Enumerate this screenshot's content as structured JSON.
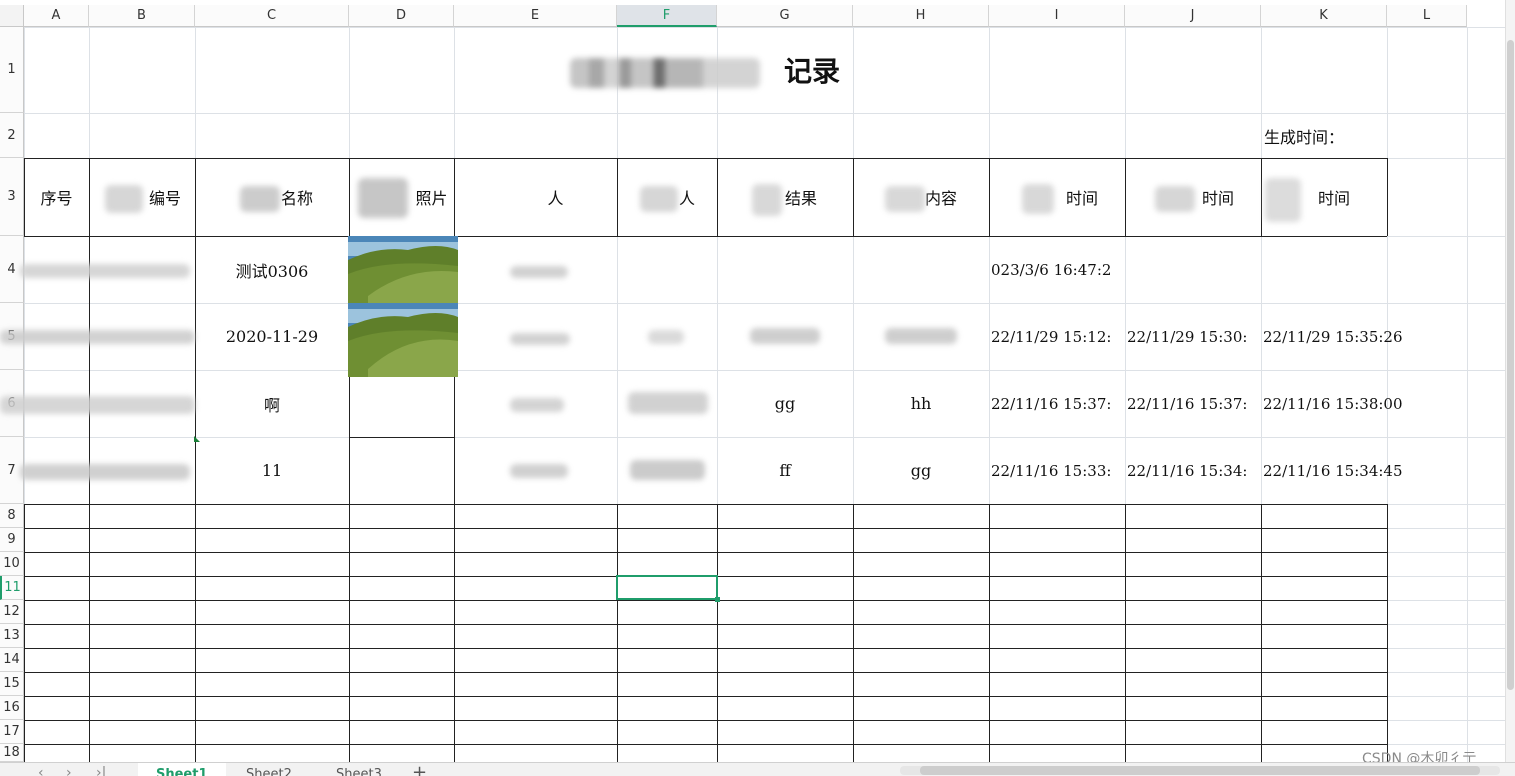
{
  "columns": [
    "A",
    "B",
    "C",
    "D",
    "E",
    "F",
    "G",
    "H",
    "I",
    "J",
    "K",
    "L"
  ],
  "rows": [
    "1",
    "2",
    "3",
    "4",
    "5",
    "6",
    "7",
    "8",
    "9",
    "10",
    "11",
    "12",
    "13",
    "14",
    "15",
    "16",
    "17",
    "18"
  ],
  "active_column": "F",
  "active_row": "11",
  "title_cell": "记录",
  "generated_label": "生成时间：",
  "headers": {
    "a": "序号",
    "b": "编号",
    "c": "名称",
    "d": "照片",
    "e": "人",
    "f": "人",
    "g": "结果",
    "h": "内容",
    "i": "时间",
    "j": "时间",
    "k": "时间"
  },
  "data_rows": [
    {
      "c": "测试0306",
      "g": "",
      "h": "",
      "i": "023/3/6 16:47:2",
      "j": "",
      "k": ""
    },
    {
      "c": "2020-11-29",
      "g": "",
      "h": "",
      "i": "22/11/29 15:12:",
      "j": "22/11/29 15:30:",
      "k": "22/11/29 15:35:26"
    },
    {
      "c": "啊",
      "g": "gg",
      "h": "hh",
      "i": "22/11/16 15:37:",
      "j": "22/11/16 15:37:",
      "k": "22/11/16 15:38:00"
    },
    {
      "c": "11",
      "g": "ff",
      "h": "gg",
      "i": "22/11/16 15:33:",
      "j": "22/11/16 15:34:",
      "k": "22/11/16 15:34:45"
    }
  ],
  "sheet_tabs": [
    "Sheet1",
    "Sheet2",
    "Sheet3"
  ],
  "add_sheet_label": "+",
  "watermark": "CSDN @木卯彳亍",
  "colors": {
    "accent": "#1f9d6b",
    "gridline": "#dde1e6",
    "border": "#222222"
  }
}
